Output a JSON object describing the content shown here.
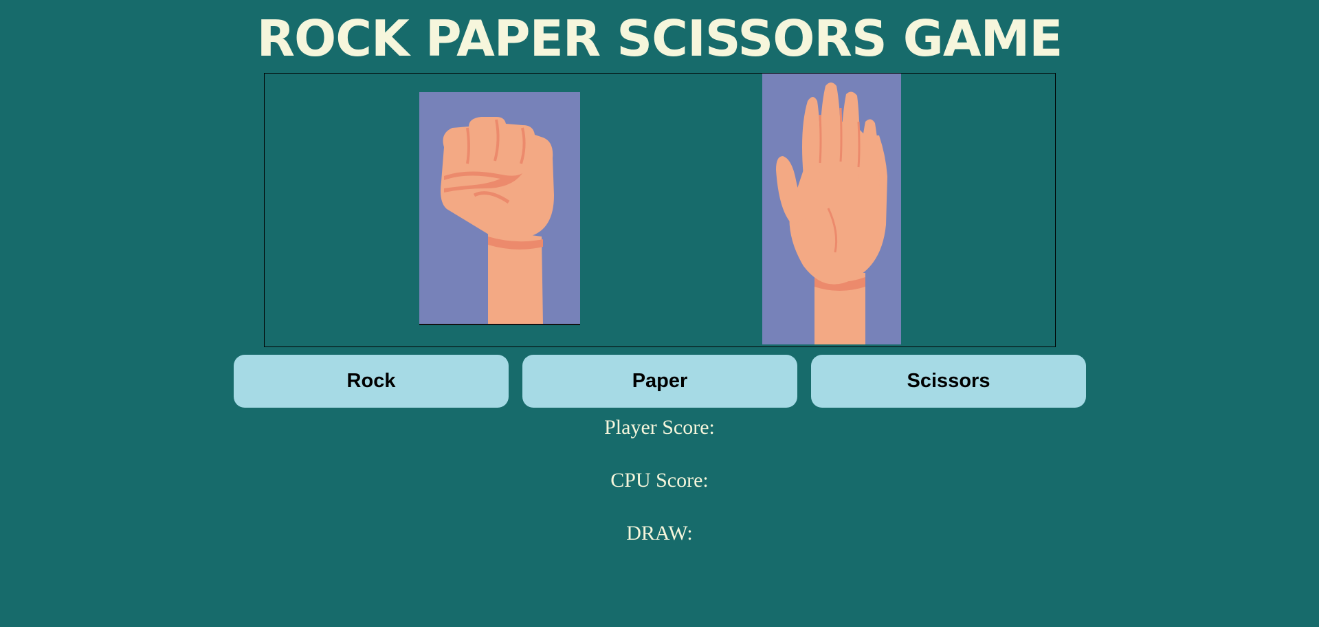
{
  "header": {
    "title": "ROCK PAPER SCISSORS GAME"
  },
  "arena": {
    "player_choice_icon": "rock-fist-icon",
    "cpu_choice_icon": "paper-open-hand-icon",
    "card_color": "#7782b9",
    "skin_color": "#f3a984",
    "skin_shadow_color": "#ec8a6c"
  },
  "controls": {
    "rock_label": "Rock",
    "paper_label": "Paper",
    "scissors_label": "Scissors",
    "button_color": "#a6dae5"
  },
  "scores": {
    "player_label": "Player Score:",
    "cpu_label": "CPU Score:",
    "draw_label": "DRAW:"
  },
  "theme": {
    "background": "#176b6b",
    "title_color": "#f6f6dc"
  }
}
